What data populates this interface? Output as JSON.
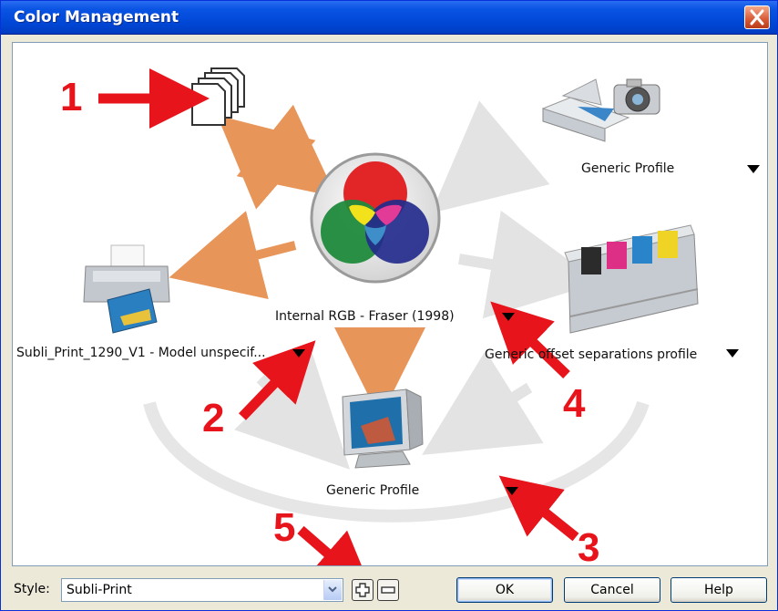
{
  "window": {
    "title": "Color Management"
  },
  "profiles": {
    "internal_rgb": "Internal RGB - Fraser (1998)",
    "scanner": "Generic Profile",
    "printer": "Subli_Print_1290_V1 - Model unspecif...",
    "press": "Generic offset separations profile",
    "monitor": "Generic Profile"
  },
  "callouts": [
    "1",
    "2",
    "3",
    "4",
    "5"
  ],
  "colors": {
    "callout": "#e8141b",
    "flow_active": "#e8955a",
    "flow_inactive": "#e3e3e3"
  },
  "footer": {
    "style_label": "Style:",
    "style_value": "Subli-Print",
    "ok": "OK",
    "cancel": "Cancel",
    "help": "Help"
  }
}
